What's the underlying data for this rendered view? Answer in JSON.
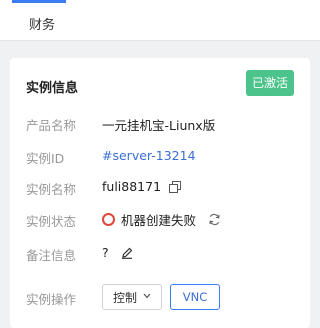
{
  "tabs": {
    "finance": "财务"
  },
  "card": {
    "title": "实例信息",
    "status_badge": "已激活",
    "rows": [
      {
        "label": "产品名称",
        "value": "一元挂机宝-Liunx版"
      },
      {
        "label": "实例ID",
        "value": "#server-13214"
      },
      {
        "label": "实例名称",
        "value": "fuli88171"
      },
      {
        "label": "实例状态",
        "value": "机器创建失败"
      },
      {
        "label": "备注信息",
        "value": "?"
      },
      {
        "label": "实例操作"
      }
    ],
    "actions": {
      "control_label": "控制",
      "vnc_label": "VNC"
    }
  },
  "colors": {
    "accent": "#3b7cf5",
    "badge": "#4cc38a",
    "error": "#e0453b",
    "link": "#3b6fd4"
  },
  "icons": [
    "copy-icon",
    "refresh-icon",
    "edit-icon",
    "error-circle-icon",
    "chevron-down-icon"
  ]
}
